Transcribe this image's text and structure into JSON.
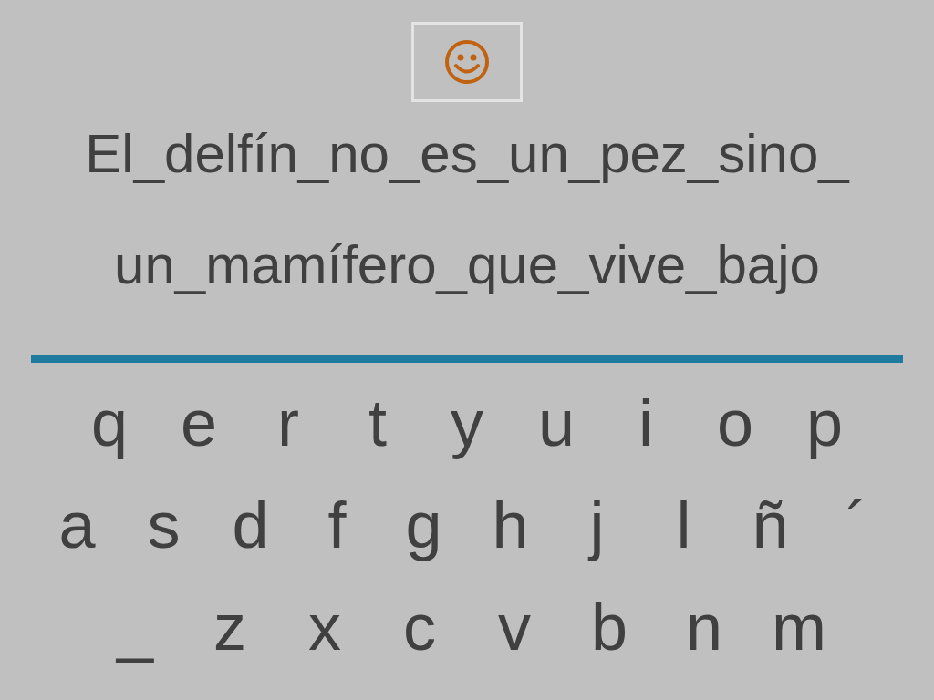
{
  "phrase_lines": [
    "El_delfín_no_es_un_pez_sino_",
    "un_mamífero_que_vive_bajo"
  ],
  "keyboard": [
    [
      "q",
      "e",
      "r",
      "t",
      "y",
      "u",
      "i",
      "o",
      "p"
    ],
    [
      "a",
      "s",
      "d",
      "f",
      "g",
      "h",
      "j",
      "l",
      "ñ",
      "´"
    ],
    [
      "_",
      "z",
      "x",
      "c",
      "v",
      "b",
      "n",
      "m"
    ]
  ]
}
